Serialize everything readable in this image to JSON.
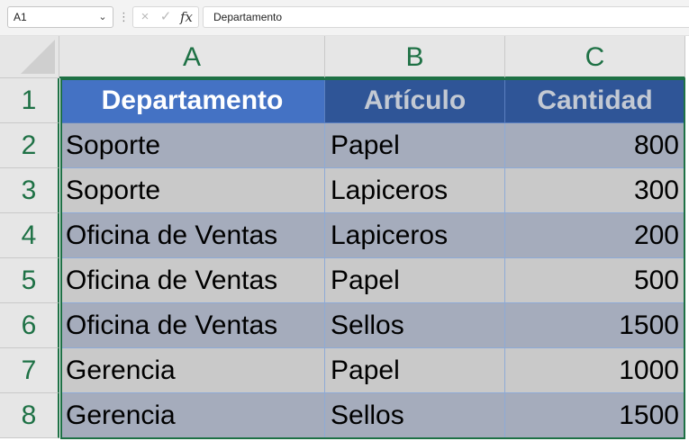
{
  "formula_bar": {
    "name_box": "A1",
    "dots": "⋮",
    "cancel_icon": "×",
    "enter_icon": "✓",
    "fx_label": "fx",
    "formula": "Departamento"
  },
  "columns": [
    "A",
    "B",
    "C"
  ],
  "rows": [
    "1",
    "2",
    "3",
    "4",
    "5",
    "6",
    "7",
    "8"
  ],
  "table": {
    "headers": [
      "Departamento",
      "Artículo",
      "Cantidad"
    ],
    "data": [
      [
        "Soporte",
        "Papel",
        "800"
      ],
      [
        "Soporte",
        "Lapiceros",
        "300"
      ],
      [
        "Oficina de Ventas",
        "Lapiceros",
        "200"
      ],
      [
        "Oficina de Ventas",
        "Papel",
        "500"
      ],
      [
        "Oficina de Ventas",
        "Sellos",
        "1500"
      ],
      [
        "Gerencia",
        "Papel",
        "1000"
      ],
      [
        "Gerencia",
        "Sellos",
        "1500"
      ]
    ]
  },
  "colors": {
    "accent": "#1e7145",
    "header_active": "#4472c4",
    "header_dark": "#2f5597",
    "band_blue": "#a5acbc",
    "band_gray": "#c9c9c9"
  }
}
